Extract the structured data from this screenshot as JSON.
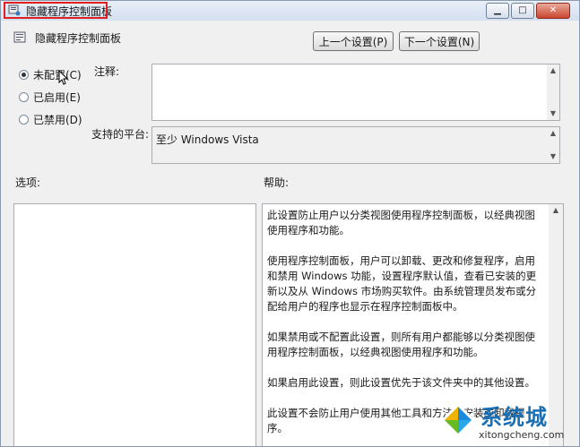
{
  "window": {
    "title": "隐藏程序控制面板",
    "controls": {
      "minimize": "▁",
      "maximize": "□",
      "close": "✕"
    }
  },
  "header": {
    "title": "隐藏程序控制面板",
    "prev_label": "上一个设置(P)",
    "next_label": "下一个设置(N)"
  },
  "state": {
    "options": [
      {
        "label": "未配置(C)",
        "selected": true
      },
      {
        "label": "已启用(E)",
        "selected": false
      },
      {
        "label": "已禁用(D)",
        "selected": false
      }
    ]
  },
  "comment": {
    "label": "注释:",
    "value": ""
  },
  "platform": {
    "label": "支持的平台:",
    "value": "至少 Windows Vista"
  },
  "options_section": {
    "label": "选项:"
  },
  "help": {
    "label": "帮助:",
    "paragraphs": [
      "此设置防止用户以分类视图使用程序控制面板，以经典视图使用程序和功能。",
      "使用程序控制面板，用户可以卸载、更改和修复程序，启用和禁用 Windows 功能，设置程序默认值，查看已安装的更新以及从 Windows 市场购买软件。由系统管理员发布或分配给用户的程序也显示在程序控制面板中。",
      "如果禁用或不配置此设置，则所有用户都能够以分类视图使用程序控制面板，以经典视图使用程序和功能。",
      "如果启用此设置，则此设置优先于该文件夹中的其他设置。",
      "此设置不会防止用户使用其他工具和方法来安装或卸载程序。"
    ]
  },
  "watermark": {
    "name": "系统城",
    "url": "xitongcheng.com"
  },
  "icons": {
    "title": "policy-icon",
    "header": "policy-icon",
    "cursor": "mouse-cursor-icon",
    "logo": "windows-logo-icon"
  }
}
